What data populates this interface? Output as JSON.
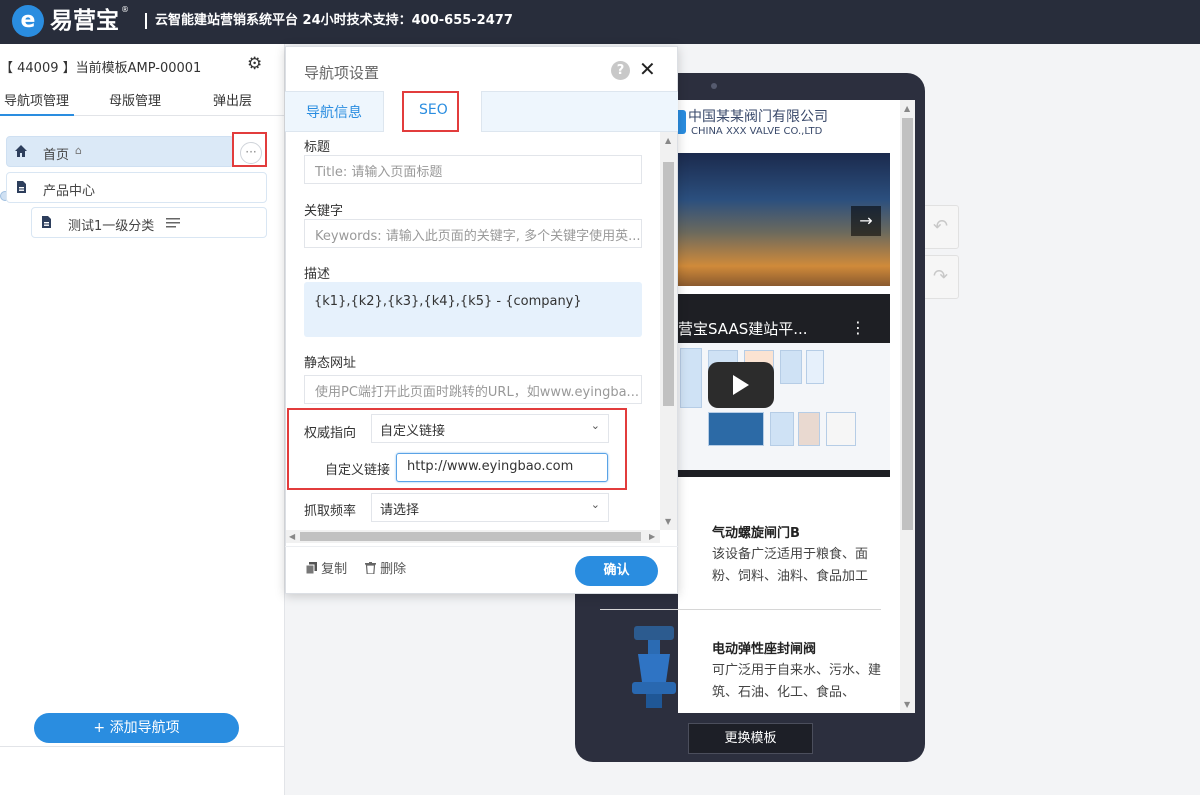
{
  "topbar": {
    "logo_letter": "e",
    "brand": "易营宝",
    "reg_mark": "®",
    "info": "云智能建站营销系统平台 24小时技术支持：400-655-2477"
  },
  "left": {
    "template_id": "【 44009 】当前模板AMP-00001",
    "tabs": [
      "导航项管理",
      "母版管理",
      "弹出层"
    ],
    "nav_items": [
      {
        "label": "首页",
        "badge": "⌂"
      },
      {
        "label": "产品中心"
      },
      {
        "label": "测试1一级分类"
      }
    ],
    "more": "···",
    "add_button": "+ 添加导航项"
  },
  "dialog": {
    "title": "导航项设置",
    "help": "?",
    "close": "✕",
    "tabs": [
      "导航信息",
      "SEO"
    ],
    "fields": {
      "title_label": "标题",
      "title_placeholder": "Title: 请输入页面标题",
      "keywords_label": "关键字",
      "keywords_placeholder": "Keywords: 请输入此页面的关键字, 多个关键字使用英...",
      "desc_label": "描述",
      "desc_value": "{k1},{k2},{k3},{k4},{k5} - {company}",
      "static_label": "静态网址",
      "static_placeholder": "使用PC端打开此页面时跳转的URL，如www.eyingba...",
      "canonical_label": "权威指向",
      "canonical_value": "自定义链接",
      "custom_link_label": "自定义链接",
      "custom_link_value": "http://www.eyingbao.com",
      "crawl_label": "抓取频率",
      "crawl_value": "请选择"
    },
    "footer": {
      "copy": "复制",
      "delete": "删除",
      "confirm": "确认"
    }
  },
  "preview": {
    "company_cn": "中国某某阀门有限公司",
    "company_en": "CHINA XXX VALVE CO.,LTD",
    "video_title": "营宝SAAS建站平...",
    "products": [
      {
        "title": "气动螺旋闸门B",
        "desc": "该设备广泛适用于粮食、面粉、饲料、油料、食品加工"
      },
      {
        "title": "电动弹性座封闸阀",
        "desc": "可广泛用于自来水、污水、建筑、石油、化工、食品、"
      }
    ],
    "change_template": "更换模板"
  },
  "colors": {
    "accent": "#2a8de0",
    "topbar": "#282d3b",
    "highlight": "#e23c3c"
  },
  "icons": [
    "gear-icon",
    "home-icon",
    "page-icon",
    "menu-lines-icon",
    "help-icon",
    "close-icon",
    "chevron-down-icon",
    "copy-icon",
    "trash-icon",
    "arrow-right-icon",
    "play-icon",
    "undo-icon",
    "redo-icon"
  ]
}
